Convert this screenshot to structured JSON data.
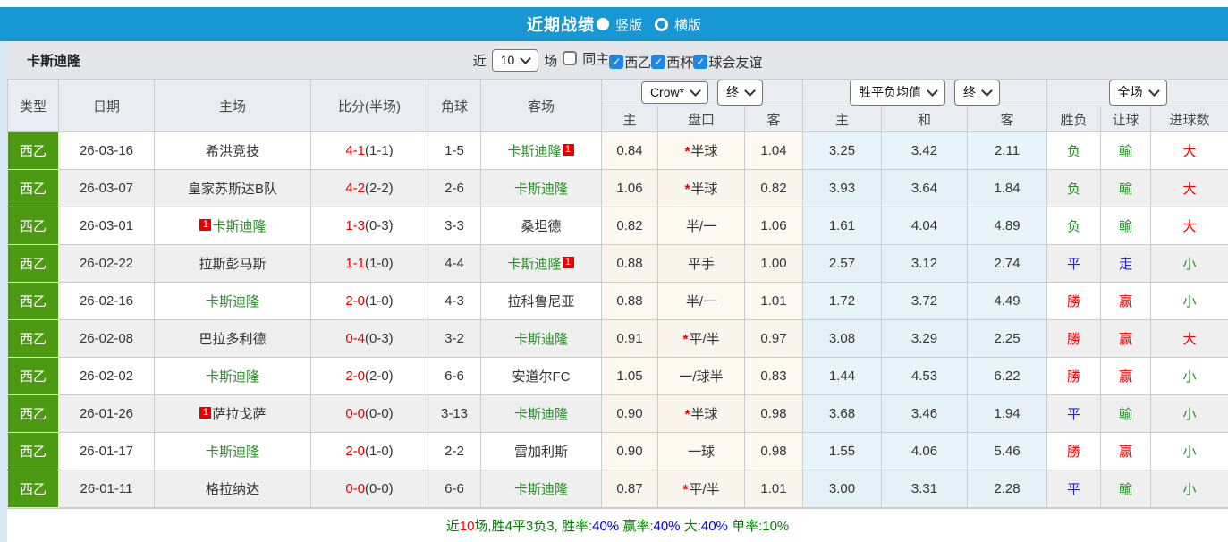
{
  "colors": {
    "titlebar_blue": "#1797d4",
    "type_badge_green": "#4c9a12",
    "main_team_green": "#2e8b2e",
    "score_red": "#e60000",
    "draw_blue": "#2323d3",
    "rate_blue": "#0000ee",
    "footer_green": "#008000",
    "checkbox_blue": "#1e88e5",
    "odds_cell_cream": "#fdf9f1",
    "avg_cell_blue": "#e9f4fa"
  },
  "titlebar": {
    "title": "近期战绩",
    "radio_vertical": "竖版",
    "radio_vertical_selected": true,
    "radio_horizontal": "横版",
    "radio_horizontal_selected": false
  },
  "filterbar": {
    "team": "卡斯迪隆",
    "recent_label": "近",
    "count_value": "10",
    "games_label": "场",
    "checkboxes": [
      {
        "label": "同主",
        "checked": false
      },
      {
        "label": "西乙",
        "checked": true
      },
      {
        "label": "西杯",
        "checked": true
      },
      {
        "label": "球会友谊",
        "checked": true
      }
    ]
  },
  "table": {
    "headers": {
      "type": "类型",
      "date": "日期",
      "home": "主场",
      "score": "比分(半场)",
      "corner": "角球",
      "away": "客场",
      "odds_home": "主",
      "odds_line": "盘口",
      "odds_away": "客",
      "avg_home": "主",
      "avg_draw": "和",
      "avg_away": "客",
      "result": "胜负",
      "handicap": "让球",
      "goals": "进球数"
    },
    "dropdowns": {
      "bookmaker": "Crow*",
      "odds_time": "终",
      "avg_label": "胜平负均值",
      "avg_time": "终",
      "fullmatch": "全场"
    },
    "rows": [
      {
        "type": "西乙",
        "date": "26-03-16",
        "home": {
          "name": "希洪竞技",
          "main": false,
          "badge": null,
          "badge_pos": null
        },
        "score": "4-1",
        "half": "(1-1)",
        "corner": "1-5",
        "away": {
          "name": "卡斯迪隆",
          "main": true,
          "badge": "1",
          "badge_pos": "after"
        },
        "line_star": true,
        "odds": [
          "0.84",
          "半球",
          "1.04"
        ],
        "avg": [
          "3.25",
          "3.42",
          "2.11"
        ],
        "result": {
          "text": "负",
          "color": "green"
        },
        "handicap": {
          "text": "輸",
          "color": "green"
        },
        "goals": {
          "text": "大",
          "color": "red"
        }
      },
      {
        "type": "西乙",
        "date": "26-03-07",
        "home": {
          "name": "皇家苏斯达B队",
          "main": false,
          "badge": null,
          "badge_pos": null
        },
        "score": "4-2",
        "half": "(2-2)",
        "corner": "2-6",
        "away": {
          "name": "卡斯迪隆",
          "main": true,
          "badge": null,
          "badge_pos": null
        },
        "line_star": true,
        "odds": [
          "1.06",
          "半球",
          "0.82"
        ],
        "avg": [
          "3.93",
          "3.64",
          "1.84"
        ],
        "result": {
          "text": "负",
          "color": "green"
        },
        "handicap": {
          "text": "輸",
          "color": "green"
        },
        "goals": {
          "text": "大",
          "color": "red"
        }
      },
      {
        "type": "西乙",
        "date": "26-03-01",
        "home": {
          "name": "卡斯迪隆",
          "main": true,
          "badge": "1",
          "badge_pos": "before"
        },
        "score": "1-3",
        "half": "(0-3)",
        "corner": "3-3",
        "away": {
          "name": "桑坦德",
          "main": false,
          "badge": null,
          "badge_pos": null
        },
        "line_star": false,
        "odds": [
          "0.82",
          "半/一",
          "1.06"
        ],
        "avg": [
          "1.61",
          "4.04",
          "4.89"
        ],
        "result": {
          "text": "负",
          "color": "green"
        },
        "handicap": {
          "text": "輸",
          "color": "green"
        },
        "goals": {
          "text": "大",
          "color": "red"
        }
      },
      {
        "type": "西乙",
        "date": "26-02-22",
        "home": {
          "name": "拉斯彭马斯",
          "main": false,
          "badge": null,
          "badge_pos": null
        },
        "score": "1-1",
        "half": "(1-0)",
        "corner": "4-4",
        "away": {
          "name": "卡斯迪隆",
          "main": true,
          "badge": "1",
          "badge_pos": "after"
        },
        "line_star": false,
        "odds": [
          "0.88",
          "平手",
          "1.00"
        ],
        "avg": [
          "2.57",
          "3.12",
          "2.74"
        ],
        "result": {
          "text": "平",
          "color": "blue"
        },
        "handicap": {
          "text": "走",
          "color": "blue"
        },
        "goals": {
          "text": "小",
          "color": "green"
        }
      },
      {
        "type": "西乙",
        "date": "26-02-16",
        "home": {
          "name": "卡斯迪隆",
          "main": true,
          "badge": null,
          "badge_pos": null
        },
        "score": "2-0",
        "half": "(1-0)",
        "corner": "4-3",
        "away": {
          "name": "拉科鲁尼亚",
          "main": false,
          "badge": null,
          "badge_pos": null
        },
        "line_star": false,
        "odds": [
          "0.88",
          "半/一",
          "1.01"
        ],
        "avg": [
          "1.72",
          "3.72",
          "4.49"
        ],
        "result": {
          "text": "勝",
          "color": "red"
        },
        "handicap": {
          "text": "赢",
          "color": "red"
        },
        "goals": {
          "text": "小",
          "color": "green"
        }
      },
      {
        "type": "西乙",
        "date": "26-02-08",
        "home": {
          "name": "巴拉多利德",
          "main": false,
          "badge": null,
          "badge_pos": null
        },
        "score": "0-4",
        "half": "(0-3)",
        "corner": "3-2",
        "away": {
          "name": "卡斯迪隆",
          "main": true,
          "badge": null,
          "badge_pos": null
        },
        "line_star": true,
        "odds": [
          "0.91",
          "平/半",
          "0.97"
        ],
        "avg": [
          "3.08",
          "3.29",
          "2.25"
        ],
        "result": {
          "text": "勝",
          "color": "red"
        },
        "handicap": {
          "text": "赢",
          "color": "red"
        },
        "goals": {
          "text": "大",
          "color": "red"
        }
      },
      {
        "type": "西乙",
        "date": "26-02-02",
        "home": {
          "name": "卡斯迪隆",
          "main": true,
          "badge": null,
          "badge_pos": null
        },
        "score": "2-0",
        "half": "(2-0)",
        "corner": "6-6",
        "away": {
          "name": "安道尔FC",
          "main": false,
          "badge": null,
          "badge_pos": null
        },
        "line_star": false,
        "odds": [
          "1.05",
          "一/球半",
          "0.83"
        ],
        "avg": [
          "1.44",
          "4.53",
          "6.22"
        ],
        "result": {
          "text": "勝",
          "color": "red"
        },
        "handicap": {
          "text": "赢",
          "color": "red"
        },
        "goals": {
          "text": "小",
          "color": "green"
        }
      },
      {
        "type": "西乙",
        "date": "26-01-26",
        "home": {
          "name": "萨拉戈萨",
          "main": false,
          "badge": "1",
          "badge_pos": "before"
        },
        "score": "0-0",
        "half": "(0-0)",
        "corner": "3-13",
        "away": {
          "name": "卡斯迪隆",
          "main": true,
          "badge": null,
          "badge_pos": null
        },
        "line_star": true,
        "odds": [
          "0.90",
          "半球",
          "0.98"
        ],
        "avg": [
          "3.68",
          "3.46",
          "1.94"
        ],
        "result": {
          "text": "平",
          "color": "blue"
        },
        "handicap": {
          "text": "輸",
          "color": "green"
        },
        "goals": {
          "text": "小",
          "color": "green"
        }
      },
      {
        "type": "西乙",
        "date": "26-01-17",
        "home": {
          "name": "卡斯迪隆",
          "main": true,
          "badge": null,
          "badge_pos": null
        },
        "score": "2-0",
        "half": "(1-0)",
        "corner": "2-2",
        "away": {
          "name": "雷加利斯",
          "main": false,
          "badge": null,
          "badge_pos": null
        },
        "line_star": false,
        "odds": [
          "0.90",
          "一球",
          "0.98"
        ],
        "avg": [
          "1.55",
          "4.06",
          "5.46"
        ],
        "result": {
          "text": "勝",
          "color": "red"
        },
        "handicap": {
          "text": "赢",
          "color": "red"
        },
        "goals": {
          "text": "小",
          "color": "green"
        }
      },
      {
        "type": "西乙",
        "date": "26-01-11",
        "home": {
          "name": "格拉纳达",
          "main": false,
          "badge": null,
          "badge_pos": null
        },
        "score": "0-0",
        "half": "(0-0)",
        "corner": "6-6",
        "away": {
          "name": "卡斯迪隆",
          "main": true,
          "badge": null,
          "badge_pos": null
        },
        "line_star": true,
        "odds": [
          "0.87",
          "平/半",
          "1.01"
        ],
        "avg": [
          "3.00",
          "3.31",
          "2.28"
        ],
        "result": {
          "text": "平",
          "color": "blue"
        },
        "handicap": {
          "text": "輸",
          "color": "green"
        },
        "goals": {
          "text": "小",
          "color": "green"
        }
      }
    ]
  },
  "footer": {
    "segments": [
      {
        "text": "近",
        "color": "green"
      },
      {
        "text": "10",
        "color": "red"
      },
      {
        "text": "场,胜4平3负3, 胜率:",
        "color": "green"
      },
      {
        "text": "40%",
        "color": "blue"
      },
      {
        "text": " 赢率:",
        "color": "green"
      },
      {
        "text": "40%",
        "color": "blue"
      },
      {
        "text": " 大:",
        "color": "green"
      },
      {
        "text": "40%",
        "color": "blue"
      },
      {
        "text": " 单率:",
        "color": "green"
      },
      {
        "text": "10%",
        "color": "green"
      }
    ]
  }
}
